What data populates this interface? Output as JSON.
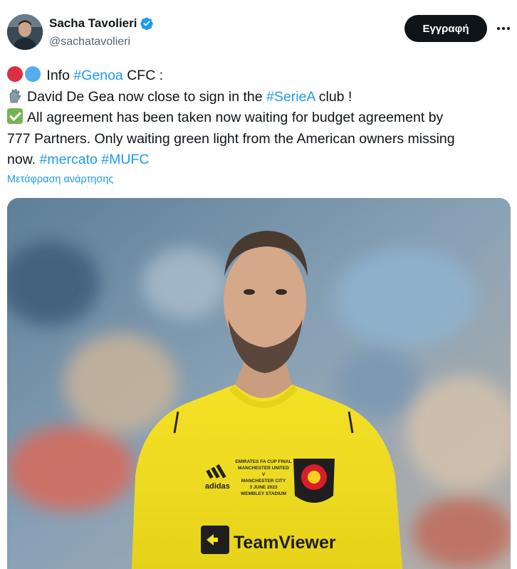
{
  "author": {
    "name": "Sacha Tavolieri",
    "handle": "@sachatavolieri",
    "verified": true,
    "verified_color": "#1d9bf0"
  },
  "actions": {
    "follow_label": "Εγγραφή",
    "more_icon": "more-horizontal-icon"
  },
  "tweet": {
    "line1": {
      "prefix": "Info ",
      "tag": "#Genoa",
      "suffix": " CFC :"
    },
    "line2": {
      "prefix": "David De Gea now close to sign in the ",
      "tag": "#SerieA",
      "suffix": " club !"
    },
    "line3": "All agreement has been taken now waiting for budget agreement by",
    "line4": "777 Partners. Only waiting green light from the American owners missing",
    "line5": {
      "prefix": "now. ",
      "tag1": "#mercato",
      "tag2": "#MUFC"
    },
    "emojis": [
      "red-circle-icon",
      "blue-circle-icon",
      "gloves-icon",
      "check-mark-icon"
    ],
    "link_color": "#1d9bf0"
  },
  "translate_label": "Μετάφραση ανάρτησης",
  "media": {
    "shirt_text": {
      "line1": "EMIRATES FA CUP FINAL",
      "line2": "MANCHESTER UNITED",
      "line3": "V",
      "line4": "MANCHESTER CITY",
      "line5": "3 JUNE 2023",
      "line6": "WEMBLEY STADIUM"
    },
    "sponsor": "TeamViewer",
    "brand": "adidas"
  }
}
